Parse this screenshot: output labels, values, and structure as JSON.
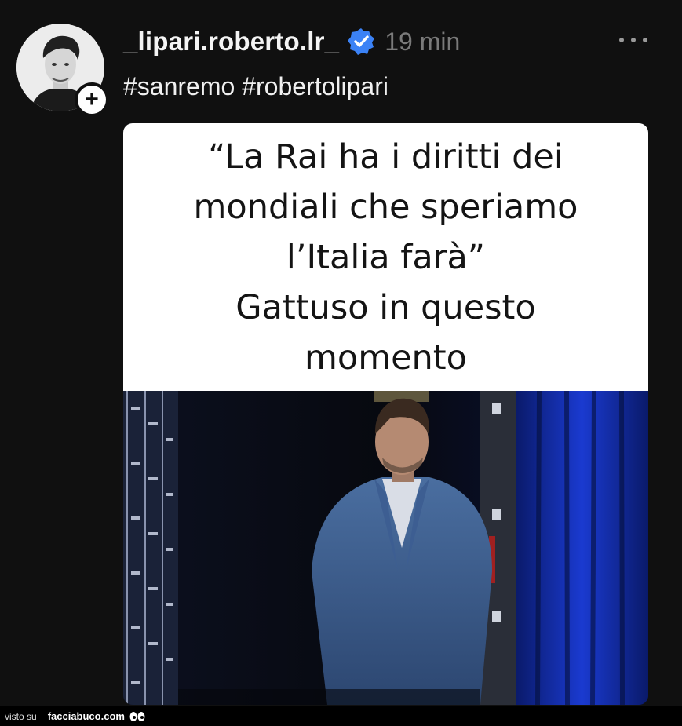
{
  "post": {
    "username": "_lipari.roberto.lr_",
    "time_ago": "19 min",
    "caption": "#sanremo #robertolipari",
    "verified_icon": "verified-badge-icon",
    "more_icon": "more-options-icon",
    "follow_icon": "plus-icon"
  },
  "media": {
    "meme_lines": [
      "“La Rai ha i diritti dei",
      "mondiali che speriamo",
      "l’Italia farà”",
      "Gattuso in questo",
      "momento"
    ]
  },
  "footer": {
    "visto_label": "visto su",
    "brand": "facciabuco.com"
  },
  "colors": {
    "background": "#101010",
    "verified": "#3b82f6",
    "time": "#7a7a7a"
  }
}
